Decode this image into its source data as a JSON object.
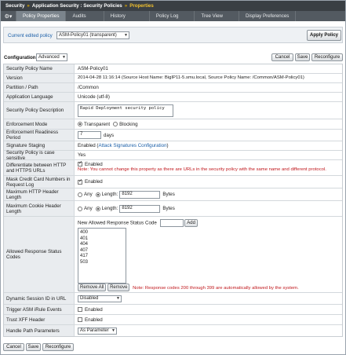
{
  "breadcrumb": {
    "item1": "Security",
    "item2": "Application Security : Security Policies",
    "item3": "Properties"
  },
  "tabs": [
    {
      "label": "Policy Properties"
    },
    {
      "label": "Audits"
    },
    {
      "label": "History"
    },
    {
      "label": "Policy Log"
    },
    {
      "label": "Tree View"
    },
    {
      "label": "Display Preferences"
    }
  ],
  "policy_bar": {
    "label": "Current edited policy",
    "selected": "ASM-Policy01 (transparent)",
    "apply_label": "Apply Policy"
  },
  "config": {
    "label": "Configuration",
    "mode": "Advanced",
    "cancel": "Cancel",
    "save": "Save",
    "reconfigure": "Reconfigure"
  },
  "rows": {
    "name": {
      "label": "Security Policy Name",
      "value": "ASM-Policy01"
    },
    "version": {
      "label": "Version",
      "value": "2014-04-28 11:16:14 (Source Host Name: BigIP11-5.smu.local, Source Policy Name: /Common/ASM-Policy01)"
    },
    "partition": {
      "label": "Partition / Path",
      "value": "/Common"
    },
    "language": {
      "label": "Application Language",
      "value": "Unicode (utf-8)"
    },
    "description": {
      "label": "Security Policy Description",
      "value": "Rapid Deployment security policy"
    },
    "enforcement": {
      "label": "Enforcement Mode",
      "opt1": "Transparent",
      "opt2": "Blocking"
    },
    "readiness": {
      "label": "Enforcement Readiness Period",
      "value": "7",
      "unit": "days"
    },
    "staging": {
      "label": "Signature Staging",
      "value": "Enabled (",
      "link": "Attack Signatures Configuration",
      "close": ")"
    },
    "case": {
      "label": "Security Policy is case sensitive",
      "value": "Yes"
    },
    "http_https": {
      "label": "Differentiate between HTTP and HTTPS URLs",
      "value": "Enabled",
      "note": "Note: You cannot change this property as there are URLs in the security policy with the same name and different protocol."
    },
    "mask_cc": {
      "label": "Mask Credit Card Numbers in Request Log",
      "value": "Enabled"
    },
    "max_header_len": {
      "label": "Maximum HTTP Header Length",
      "any": "Any",
      "length": "Length:",
      "value": "8192",
      "unit": "Bytes"
    },
    "max_cookie_len": {
      "label": "Maximum Cookie Header Length",
      "any": "Any",
      "length": "Length:",
      "value": "8192",
      "unit": "Bytes"
    },
    "allowed_codes": {
      "label": "Allowed Response Status Codes",
      "new_label": "New Allowed Response Status Code",
      "add": "Add",
      "codes": [
        "400",
        "401",
        "404",
        "407",
        "417",
        "503"
      ],
      "remove_all": "Remove All",
      "remove": "Remove",
      "note": "Note: Response codes 200 through 399 are automatically allowed by the system."
    },
    "session_id": {
      "label": "Dynamic Session ID in URL",
      "value": "Disabled"
    },
    "irule": {
      "label": "Trigger ASM iRule Events",
      "value": "Enabled"
    },
    "xff": {
      "label": "Trust XFF Header",
      "value": "Enabled"
    },
    "path_params": {
      "label": "Handle Path Parameters",
      "value": "As Parameter"
    }
  },
  "bottom": {
    "cancel": "Cancel",
    "save": "Save",
    "reconfigure": "Reconfigure"
  }
}
